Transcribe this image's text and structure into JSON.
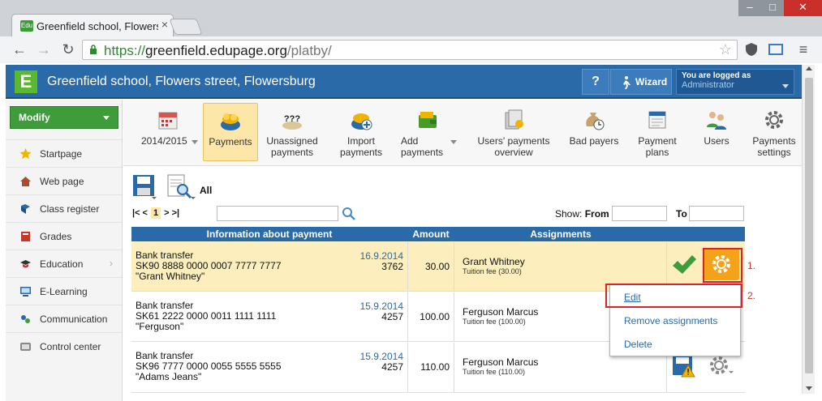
{
  "browser": {
    "tab_title": "Greenfield school, Flowers",
    "tab_favicon": "Edu",
    "url_scheme": "https://",
    "url_domain": "greenfield.edupage.org",
    "url_path": "/platby/"
  },
  "header": {
    "school_name": "Greenfield school, Flowers street, Flowersburg",
    "help_label": "?",
    "wizard_label": "Wizard",
    "login_line1": "You are logged as",
    "login_line2": "Administrator",
    "logo_letter": "E"
  },
  "sidebar": {
    "modify_label": "Modify",
    "items": [
      {
        "label": "Startpage",
        "icon": "star-icon"
      },
      {
        "label": "Web page",
        "icon": "house-icon"
      },
      {
        "label": "Class register",
        "icon": "book-icon"
      },
      {
        "label": "Grades",
        "icon": "grades-icon"
      },
      {
        "label": "Education",
        "icon": "education-icon"
      },
      {
        "label": "E-Learning",
        "icon": "elearning-icon"
      },
      {
        "label": "Communication",
        "icon": "communication-icon"
      },
      {
        "label": "Control center",
        "icon": "control-center-icon"
      }
    ]
  },
  "toolbar": {
    "items": [
      {
        "label": "2014/2015",
        "icon": "calendar-icon"
      },
      {
        "label": "Payments",
        "icon": "coins-icon"
      },
      {
        "label": "Unassigned payments",
        "icon": "question-coins-icon"
      },
      {
        "label": "Import payments",
        "icon": "import-coins-icon"
      },
      {
        "label": "Add payments",
        "icon": "wallet-icon"
      },
      {
        "label": "Users' payments overview",
        "icon": "overview-icon"
      },
      {
        "label": "Bad payers",
        "icon": "moneybag-clock-icon"
      },
      {
        "label": "Payment plans",
        "icon": "plan-calendar-icon"
      },
      {
        "label": "Users",
        "icon": "users-icon"
      },
      {
        "label": "Payments settings",
        "icon": "gear-icon"
      }
    ]
  },
  "filter": {
    "all_label": "All",
    "pager_first": "|< <",
    "pager_page": "1",
    "pager_last": "> >|",
    "show_label": "Show:",
    "from_label": "From",
    "to_label": "To"
  },
  "table": {
    "headers": [
      "Information about payment",
      "Amount",
      "Assignments"
    ],
    "rows": [
      {
        "type": "Bank transfer",
        "account": "SK90 8888 0000 0007 7777 7777",
        "name": "\"Grant Whitney\"",
        "date": "16.9.2014",
        "ref": "3762",
        "amount": "30.00",
        "assignee": "Grant Whitney",
        "fee": "Tuition fee (30.00)"
      },
      {
        "type": "Bank transfer",
        "account": "SK61 2222 0000 0011 1111 1111",
        "name": "\"Ferguson\"",
        "date": "15.9.2014",
        "ref": "4257",
        "amount": "100.00",
        "assignee": "Ferguson Marcus",
        "fee": "Tuition fee (100.00)"
      },
      {
        "type": "Bank transfer",
        "account": "SK96 7777 0000 0055 5555 5555",
        "name": "\"Adams Jeans\"",
        "date": "15.9.2014",
        "ref": "4257",
        "amount": "110.00",
        "assignee": "Ferguson Marcus",
        "fee": "Tuition fee (110.00)"
      }
    ]
  },
  "context_menu": {
    "edit": "Edit",
    "remove": "Remove assignments",
    "delete": "Delete"
  },
  "annotations": {
    "step1": "1.",
    "step2": "2."
  },
  "colors": {
    "header_blue": "#2b6aa8",
    "selected_row": "#fcefbd",
    "accent_green": "#3e9c3b",
    "annotation_red": "#d9242a"
  }
}
